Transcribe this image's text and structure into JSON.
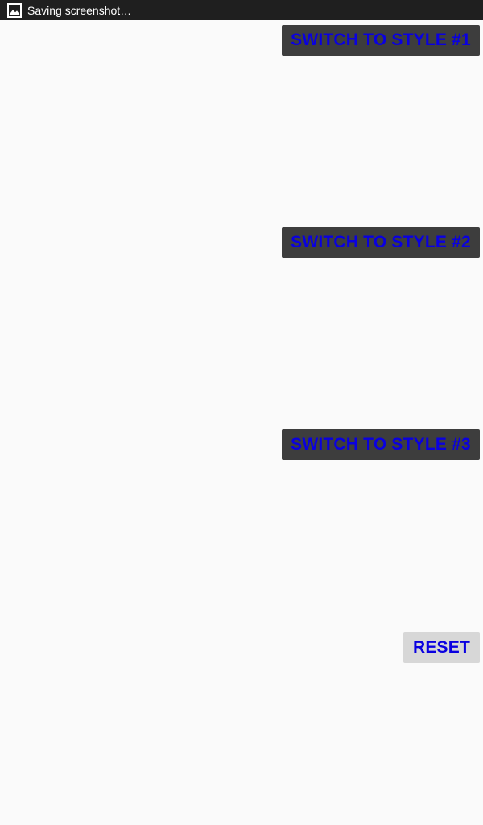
{
  "status_bar": {
    "notification_icon": "image-icon",
    "notification_text": "Saving screenshot…",
    "background_color": "#1f1f1f"
  },
  "buttons": {
    "style1_label": "SWITCH TO STYLE #1",
    "style2_label": "SWITCH TO STYLE #2",
    "style3_label": "SWITCH TO STYLE #3",
    "reset_label": "RESET"
  },
  "colors": {
    "label_text": "#0a00e0",
    "dark_button_bg": "#3d3d3d",
    "reset_button_bg": "#d7d7d7",
    "page_bg": "#fafafa"
  }
}
